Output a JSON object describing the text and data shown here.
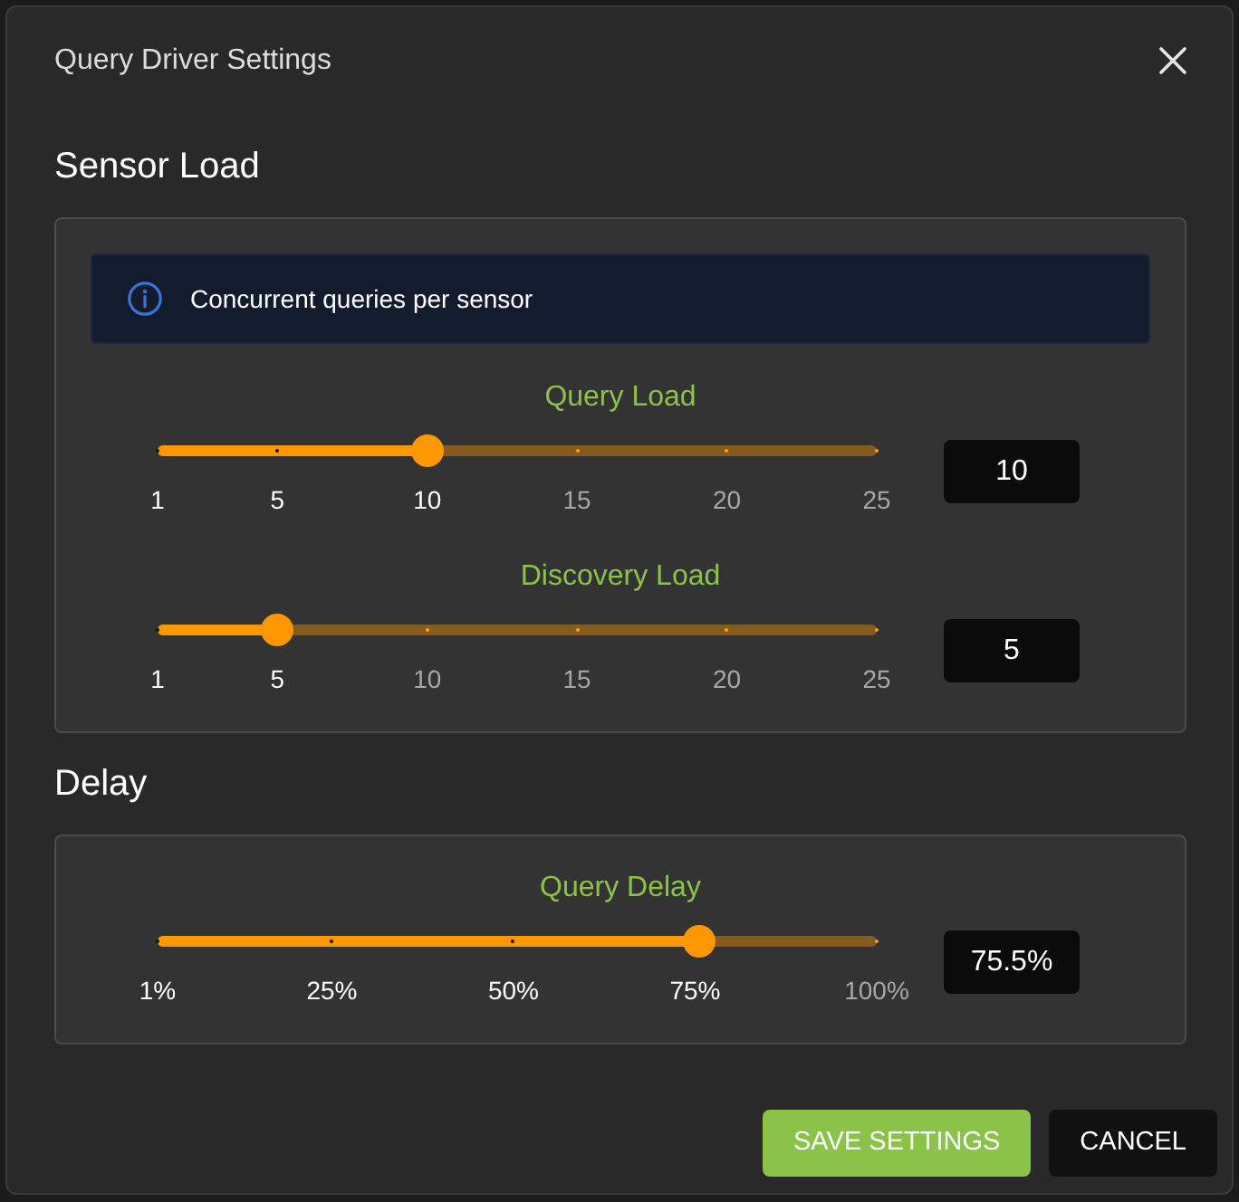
{
  "dialog": {
    "title": "Query Driver Settings"
  },
  "sections": [
    {
      "heading": "Sensor Load",
      "info": "Concurrent queries per sensor",
      "sliders": [
        {
          "label": "Query Load",
          "level": 0.375,
          "value": "10",
          "marks": [
            {
              "label": "1",
              "level": 0,
              "active": true
            },
            {
              "label": "5",
              "level": 0.1667,
              "active": true
            },
            {
              "label": "10",
              "level": 0.375,
              "active": true
            },
            {
              "label": "15",
              "level": 0.5833,
              "active": false
            },
            {
              "label": "20",
              "level": 0.7917,
              "active": false
            },
            {
              "label": "25",
              "level": 1,
              "active": false
            }
          ]
        },
        {
          "label": "Discovery Load",
          "level": 0.1667,
          "value": "5",
          "marks": [
            {
              "label": "1",
              "level": 0,
              "active": true
            },
            {
              "label": "5",
              "level": 0.1667,
              "active": true
            },
            {
              "label": "10",
              "level": 0.375,
              "active": false
            },
            {
              "label": "15",
              "level": 0.5833,
              "active": false
            },
            {
              "label": "20",
              "level": 0.7917,
              "active": false
            },
            {
              "label": "25",
              "level": 1,
              "active": false
            }
          ]
        }
      ]
    },
    {
      "heading": "Delay",
      "sliders": [
        {
          "label": "Query Delay",
          "level": 0.7525,
          "value": "75.5%",
          "marks": [
            {
              "label": "1%",
              "level": 0,
              "active": true
            },
            {
              "label": "25%",
              "level": 0.2424,
              "active": true
            },
            {
              "label": "50%",
              "level": 0.4949,
              "active": true
            },
            {
              "label": "75%",
              "level": 0.7475,
              "active": true
            },
            {
              "label": "100%",
              "level": 1,
              "active": false
            }
          ]
        }
      ]
    }
  ],
  "buttons": [
    {
      "label": "SAVE SETTINGS",
      "kind": "primary"
    },
    {
      "label": "CANCEL",
      "kind": "secondary"
    }
  ]
}
